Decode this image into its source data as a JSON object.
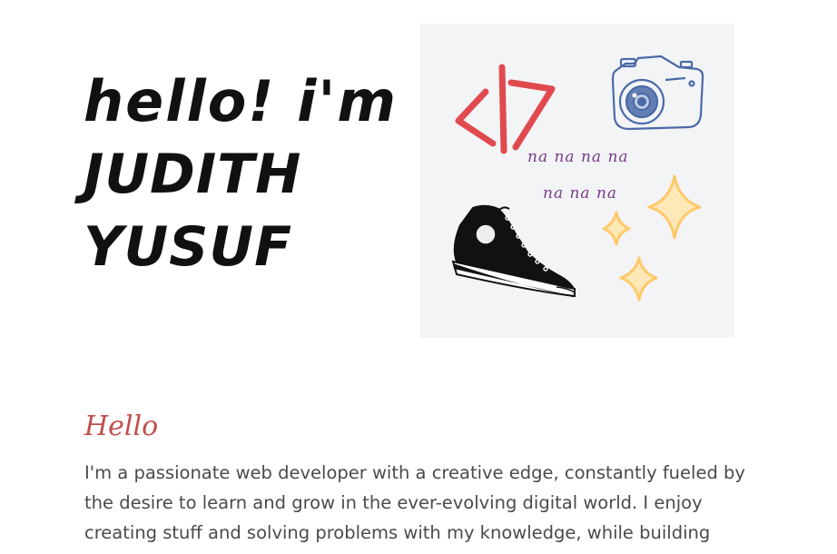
{
  "hero": {
    "greeting": "hello! i'm",
    "first_name": "JUDITH",
    "last_name": "YUSUF"
  },
  "illustration": {
    "lyrics_line_1": "na na na na",
    "lyrics_line_2": "na na na",
    "icons": [
      "code-icon",
      "camera-icon",
      "sneaker-icon",
      "sparkle-icon"
    ],
    "colors": {
      "background": "#f3f4f6",
      "code": "#e04a4f",
      "camera": "#4a6aa8",
      "lyrics": "#7a3a8a",
      "sparkle": "#ffd27a"
    }
  },
  "about": {
    "heading": "Hello",
    "body": "I'm a passionate web developer with a creative edge, constantly fueled by the desire to learn and grow in the ever-evolving digital world. I enjoy creating stuff and solving problems with my knowledge, while building"
  }
}
